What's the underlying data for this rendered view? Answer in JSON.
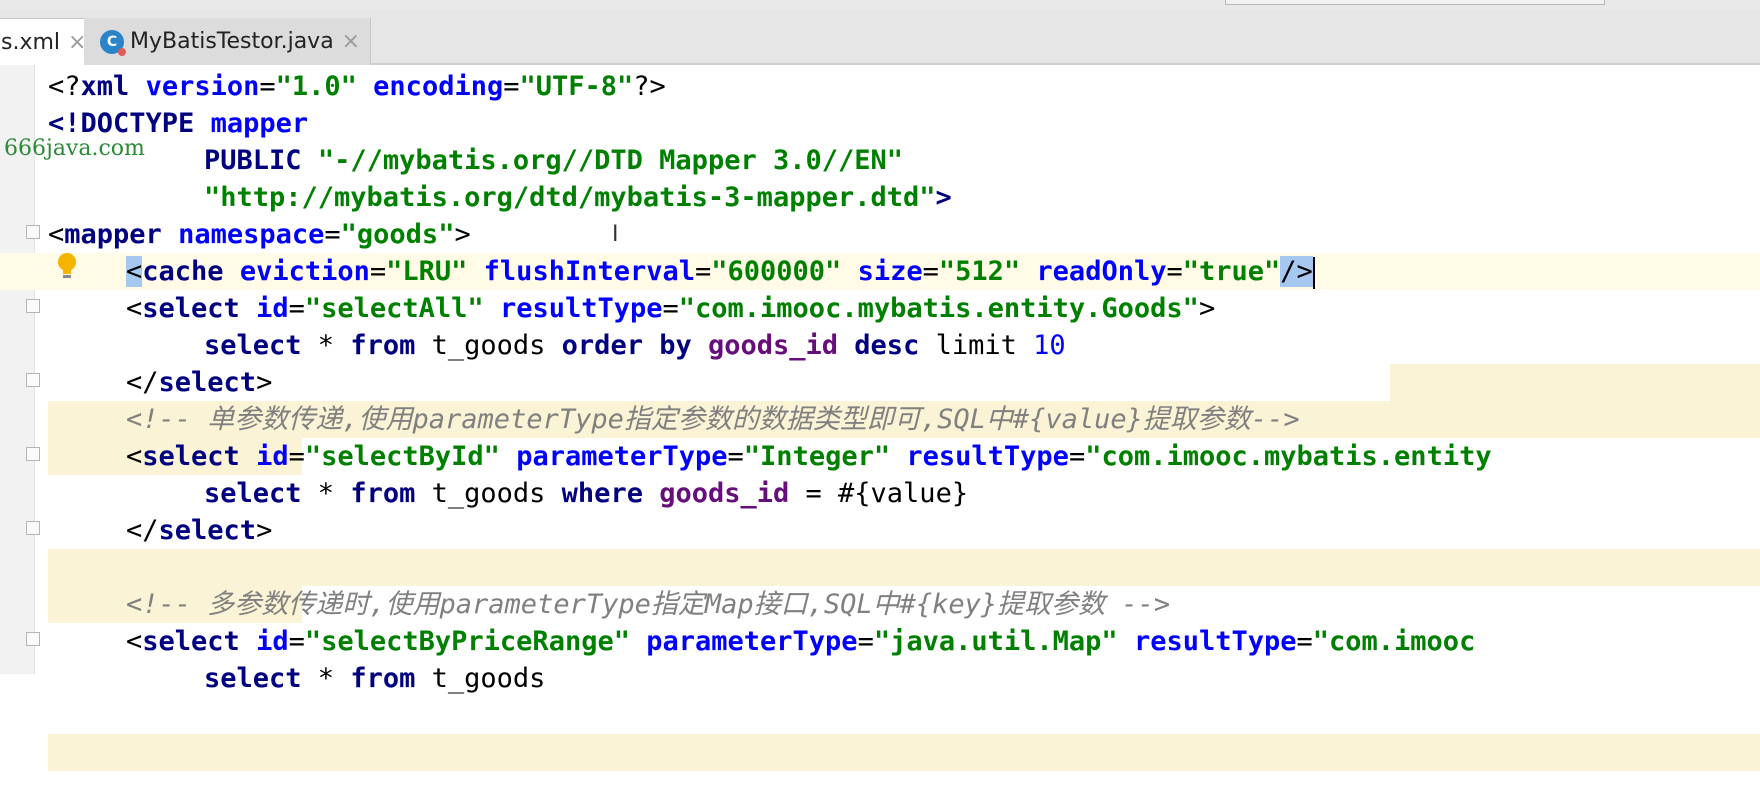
{
  "tabs": [
    {
      "label": "s.xml",
      "active": true
    },
    {
      "label": "MyBatisTestor.java",
      "active": false
    }
  ],
  "tab_close_glyph": "×",
  "class_icon_letter": "C",
  "watermark": "666java.com",
  "lines": {
    "l1": {
      "lt": "<?",
      "tag": "xml",
      "a1": "version",
      "eq1": "=",
      "v1": "\"1.0\"",
      "a2": "encoding",
      "eq2": "=",
      "v2": "\"UTF-8\"",
      "end": "?>"
    },
    "l2": {
      "doctype": "<!DOCTYPE",
      "name": "mapper"
    },
    "l3": {
      "public": "PUBLIC",
      "v": "\"-//mybatis.org//DTD Mapper 3.0//EN\""
    },
    "l4": {
      "v": "\"http://mybatis.org/dtd/mybatis-3-mapper.dtd\"",
      "gt": ">"
    },
    "l5": {
      "lt": "<",
      "tag": "mapper",
      "a": "namespace",
      "eq": "=",
      "v": "\"goods\"",
      "gt": ">"
    },
    "l6": {
      "lt": "<",
      "tag": "cache",
      "a1": "eviction",
      "eq1": "=",
      "v1": "\"LRU\"",
      "a2": "flushInterval",
      "eq2": "=",
      "v2": "\"600000\"",
      "a3": "size",
      "eq3": "=",
      "v3": "\"512\"",
      "a4": "readOnly",
      "eq4": "=",
      "v4": "\"true\"",
      "end": "/>"
    },
    "l7": {
      "lt": "<",
      "tag": "select",
      "a1": "id",
      "eq1": "=",
      "v1": "\"selectAll\"",
      "a2": "resultType",
      "eq2": "=",
      "v2": "\"com.imooc.mybatis.entity.Goods\"",
      "gt": ">"
    },
    "l8": {
      "k1": "select",
      "p1": " * ",
      "k2": "from",
      "p2": " t_goods ",
      "k3": "order by",
      "c1": "goods_id",
      "k4": "desc",
      "p3": " limit ",
      "n": "10"
    },
    "l9": {
      "close": "</",
      "tag": "select",
      "gt": ">"
    },
    "l10": {
      "comment": "<!-- 单参数传递,使用parameterType指定参数的数据类型即可,SQL中#{value}提取参数-->"
    },
    "l11": {
      "lt": "<",
      "tag": "select",
      "a1": "id",
      "eq1": "=",
      "v1": "\"selectById\"",
      "a2": "parameterType",
      "eq2": "=",
      "v2": "\"Integer\"",
      "a3": "resultType",
      "eq3": "=",
      "v3": "\"com.imooc.mybatis.entity"
    },
    "l12": {
      "k1": "select",
      "p1": " * ",
      "k2": "from",
      "p2": " t_goods ",
      "k3": "where",
      "c1": "goods_id",
      "p3": " = #{value}"
    },
    "l13": {
      "close": "</",
      "tag": "select",
      "gt": ">"
    },
    "l15": {
      "comment": "<!-- 多参数传递时,使用parameterType指定Map接口,SQL中#{key}提取参数 -->"
    },
    "l16": {
      "lt": "<",
      "tag": "select",
      "a1": "id",
      "eq1": "=",
      "v1": "\"selectByPriceRange\"",
      "a2": "parameterType",
      "eq2": "=",
      "v2": "\"java.util.Map\"",
      "a3": "resultType",
      "eq3": "=",
      "v3": "\"com.imooc"
    },
    "l17": {
      "k1": "select",
      "p1": " * ",
      "k2": "from",
      "p2": " t_goods"
    }
  },
  "colors": {
    "tag": "#000080",
    "attribute": "#0000ff",
    "string": "#008000",
    "column": "#660e7a",
    "comment": "#808080",
    "highlight": "#fbf3d5",
    "selection": "#a6c8f0"
  },
  "icons": [
    "class-icon",
    "lightbulb-icon",
    "fold-icon",
    "close-icon",
    "text-cursor-icon"
  ]
}
